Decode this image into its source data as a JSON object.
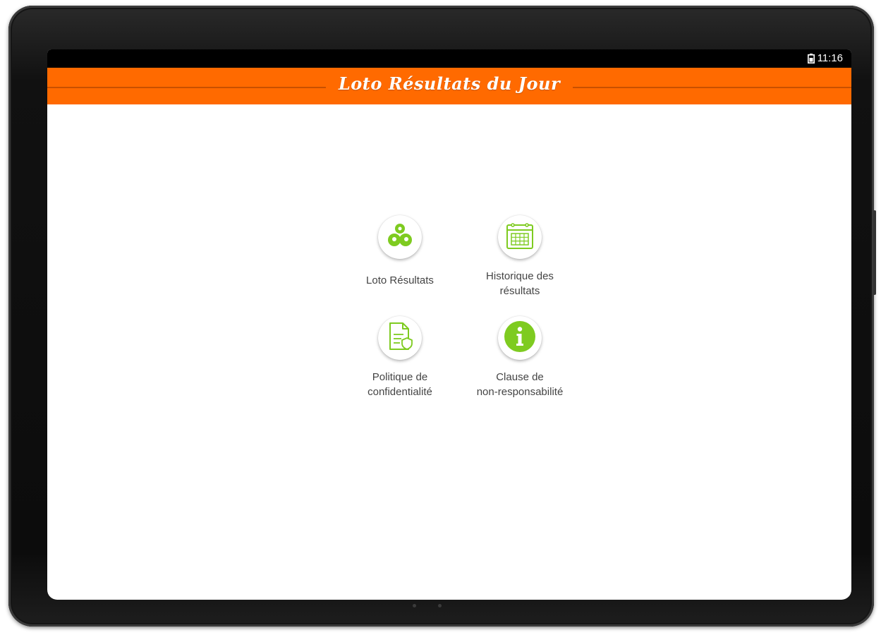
{
  "status_bar": {
    "time": "11:16",
    "battery_icon": "battery-icon"
  },
  "app_bar": {
    "title": "Loto Résultats du Jour"
  },
  "menu": [
    {
      "label": "Loto Résultats",
      "icon": "lottery-balls-icon"
    },
    {
      "label": "Historique des\nrésultats",
      "icon": "calendar-icon"
    },
    {
      "label": "Politique de\nconfidentialité",
      "icon": "document-shield-icon"
    },
    {
      "label": "Clause de\nnon-responsabilité",
      "icon": "info-icon"
    }
  ],
  "colors": {
    "primary": "#ff6a00",
    "accent": "#7ecb20",
    "text": "#444444"
  }
}
